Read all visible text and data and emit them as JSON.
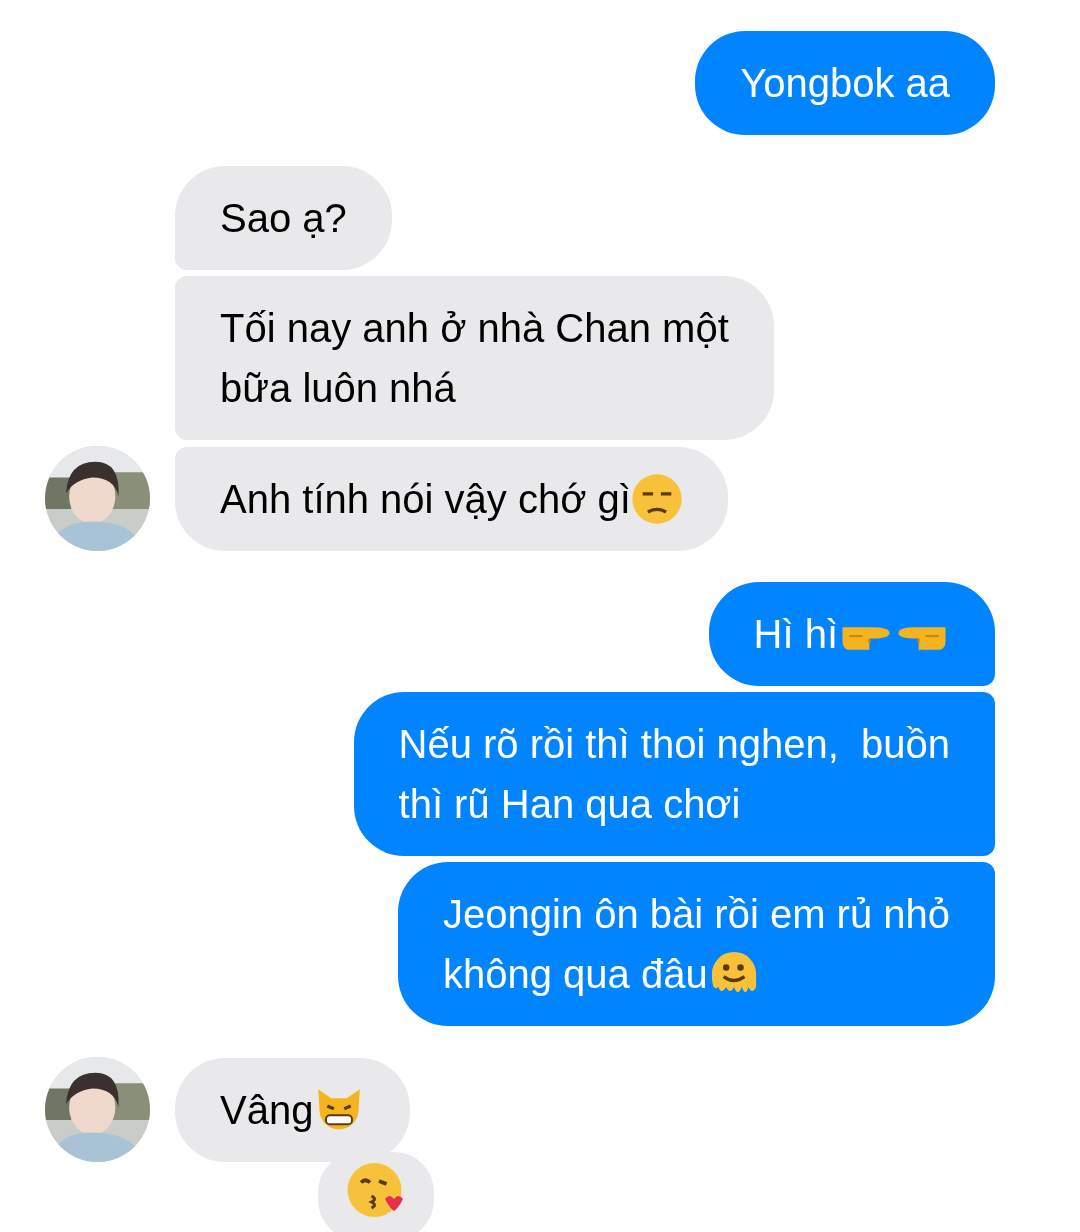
{
  "messages": [
    {
      "kind": "outgoing",
      "lines": [
        "Yongbok aa"
      ]
    },
    {
      "kind": "incoming",
      "lines": [
        "Sao ạ?"
      ]
    },
    {
      "kind": "incoming",
      "lines": [
        "Tối nay anh ở nhà Chan một",
        "bữa luôn nhá"
      ]
    },
    {
      "kind": "incoming",
      "lines": [
        "Anh tính nói vậy chớ gì"
      ],
      "emojis": [
        {
          "kind": "unamused"
        }
      ],
      "avatar": true
    },
    {
      "kind": "outgoing",
      "lines": [
        "Hì hì"
      ],
      "emojis": [
        {
          "kind": "point-right"
        },
        {
          "kind": "point-left"
        }
      ]
    },
    {
      "kind": "outgoing",
      "lines": [
        "Nếu rõ rồi thì thoi nghen,  buồn",
        "thì rũ Han qua chơi"
      ]
    },
    {
      "kind": "outgoing",
      "lines": [
        "Jeongin ôn bài rồi em rủ nhỏ",
        "không qua đâu"
      ],
      "emojis": [
        {
          "kind": "melting"
        }
      ]
    },
    {
      "kind": "incoming",
      "lines": [
        "Vâng"
      ],
      "emojis": [
        {
          "kind": "cat"
        }
      ],
      "avatar": true
    },
    {
      "kind": "reaction",
      "emojis": [
        {
          "kind": "kiss"
        }
      ]
    }
  ]
}
